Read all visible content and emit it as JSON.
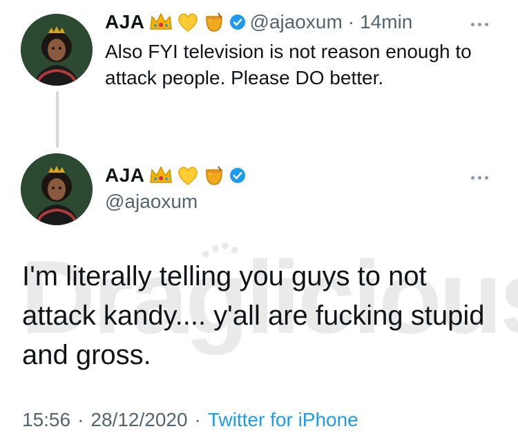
{
  "reply_tweet": {
    "name": "AJA",
    "handle": "@ajaoxum",
    "time": "14min",
    "text": "Also FYI television is not reason enough to attack people. Please DO better.",
    "emojis": [
      "crown-emoji",
      "yellow-heart-emoji",
      "honey-pot-emoji"
    ],
    "verified_icon": "verified-badge-icon",
    "more_icon": "more-options-icon"
  },
  "main_tweet": {
    "name": "AJA",
    "handle": "@ajaoxum",
    "text": "I'm literally telling you guys to not attack kandy.... y'all are fucking stupid and gross.",
    "emojis": [
      "crown-emoji",
      "yellow-heart-emoji",
      "honey-pot-emoji"
    ],
    "verified_icon": "verified-badge-icon",
    "more_icon": "more-options-icon",
    "timestamp_time": "15:56",
    "timestamp_date": "28/12/2020",
    "source": "Twitter for iPhone"
  },
  "watermark": {
    "text": "Draglicious"
  },
  "colors": {
    "text_primary": "#0f1419",
    "text_secondary": "#536471",
    "accent_blue": "#1d9bf0",
    "thread_line": "#cfd9de"
  }
}
